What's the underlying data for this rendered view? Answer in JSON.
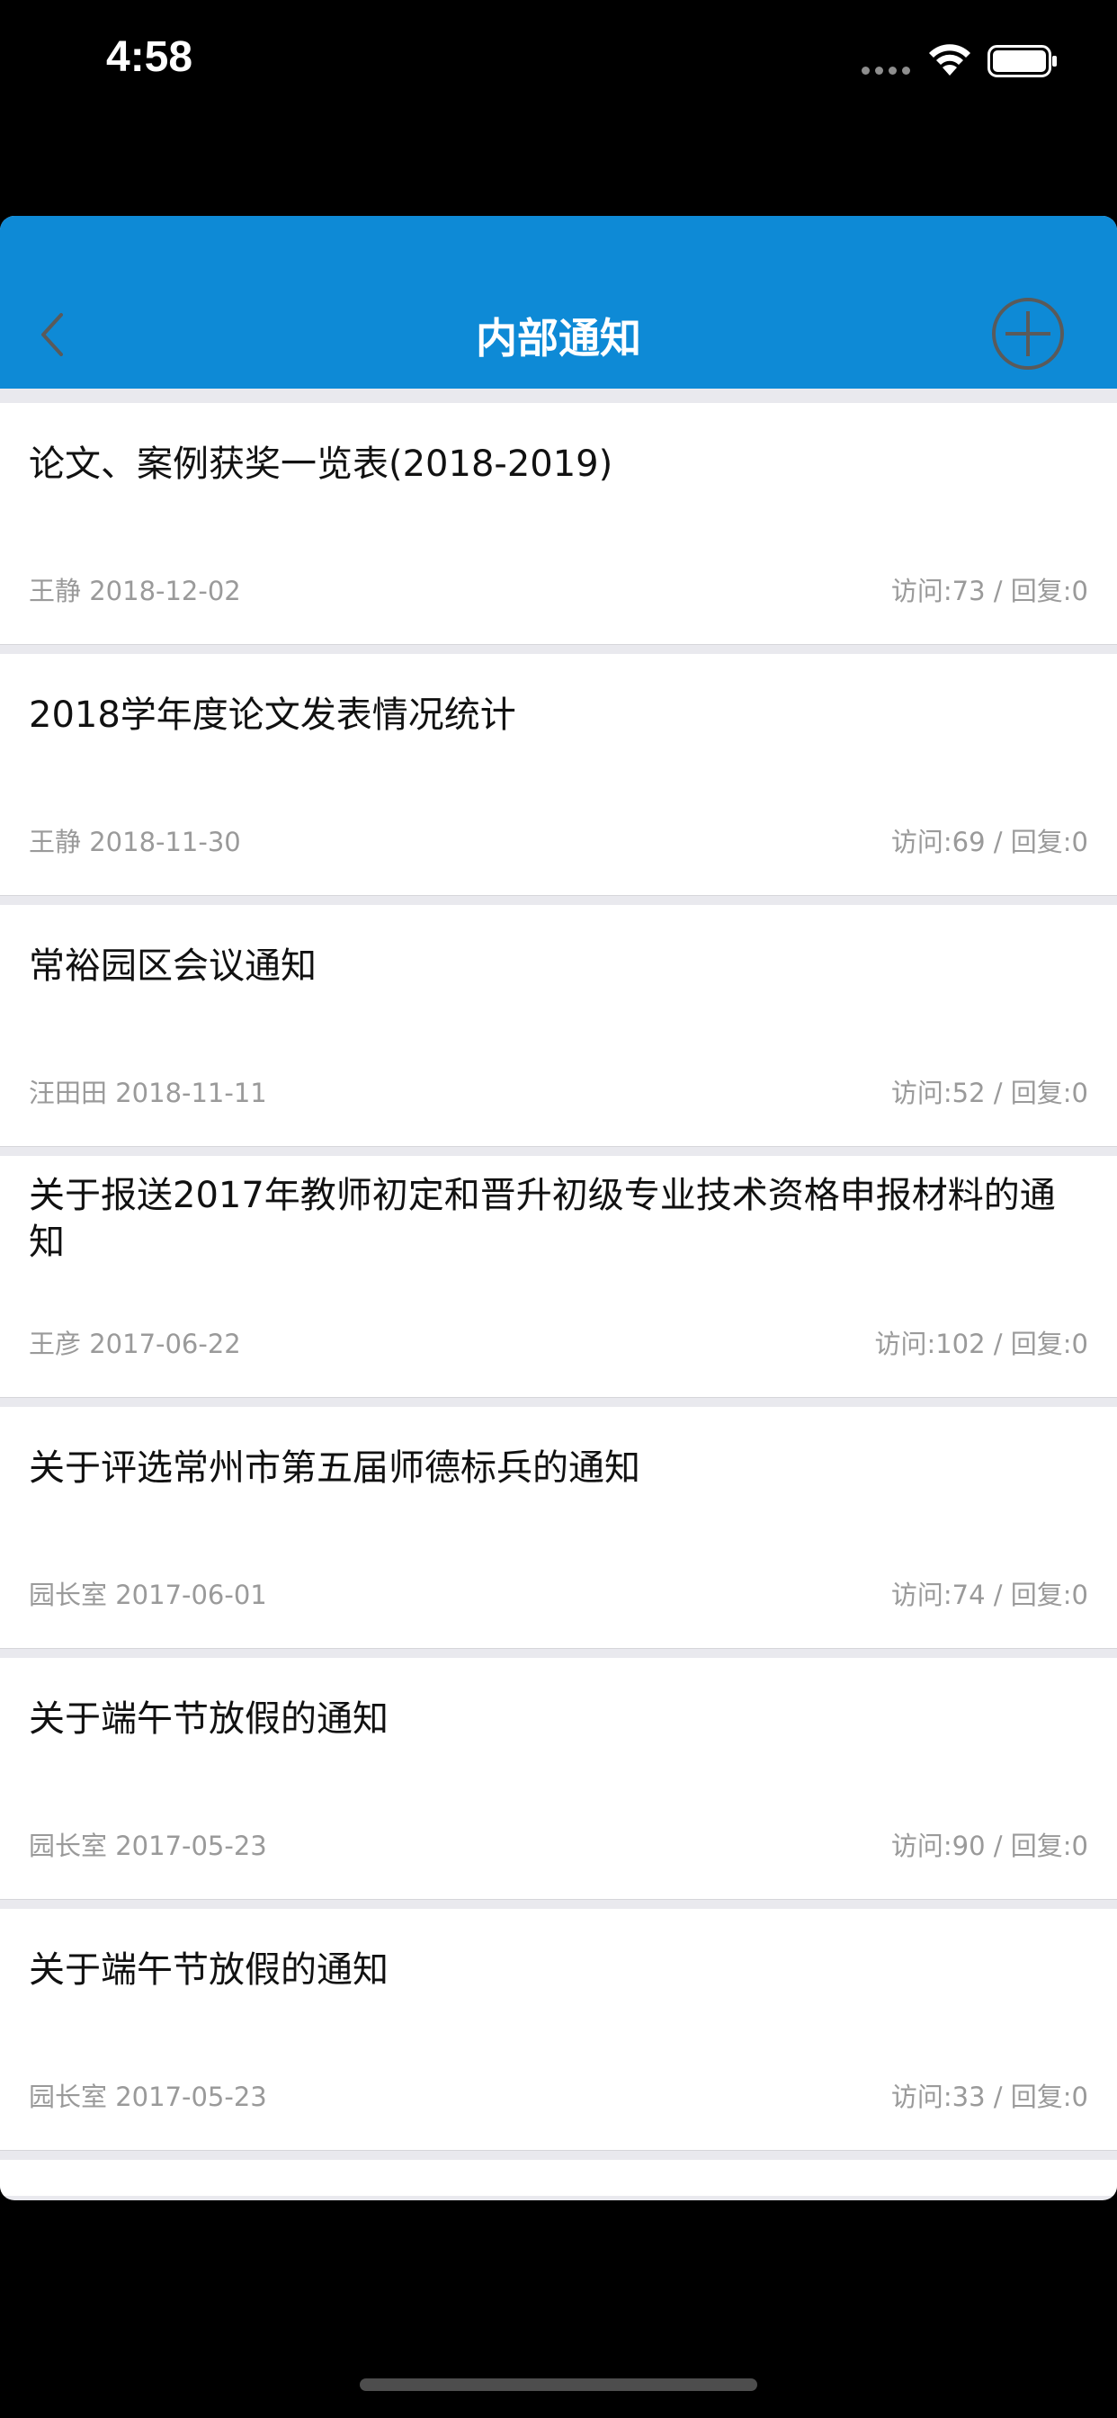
{
  "status_bar": {
    "time": "4:58"
  },
  "nav": {
    "title": "内部通知",
    "back_icon": "chevron-left-icon",
    "add_icon": "plus-circle-icon"
  },
  "notices": [
    {
      "title": "论文、案例获奖一览表(2018-2019)",
      "author_date": "王静 2018-12-02",
      "stats": "访问:73 / 回复:0"
    },
    {
      "title": "2018学年度论文发表情况统计",
      "author_date": "王静 2018-11-30",
      "stats": "访问:69 / 回复:0"
    },
    {
      "title": "常裕园区会议通知",
      "author_date": "汪田田 2018-11-11",
      "stats": "访问:52 / 回复:0"
    },
    {
      "title": "关于报送2017年教师初定和晋升初级专业技术资格申报材料的通知",
      "author_date": "王彦 2017-06-22",
      "stats": "访问:102 / 回复:0"
    },
    {
      "title": "关于评选常州市第五届师德标兵的通知",
      "author_date": "园长室 2017-06-01",
      "stats": "访问:74 / 回复:0"
    },
    {
      "title": "关于端午节放假的通知",
      "author_date": "园长室 2017-05-23",
      "stats": "访问:90 / 回复:0"
    },
    {
      "title": "关于端午节放假的通知",
      "author_date": "园长室 2017-05-23",
      "stats": "访问:33 / 回复:0"
    }
  ],
  "colors": {
    "nav_background": "#0e8ad6",
    "list_background": "#e9e9ee",
    "meta_text": "#9a9a9a"
  }
}
